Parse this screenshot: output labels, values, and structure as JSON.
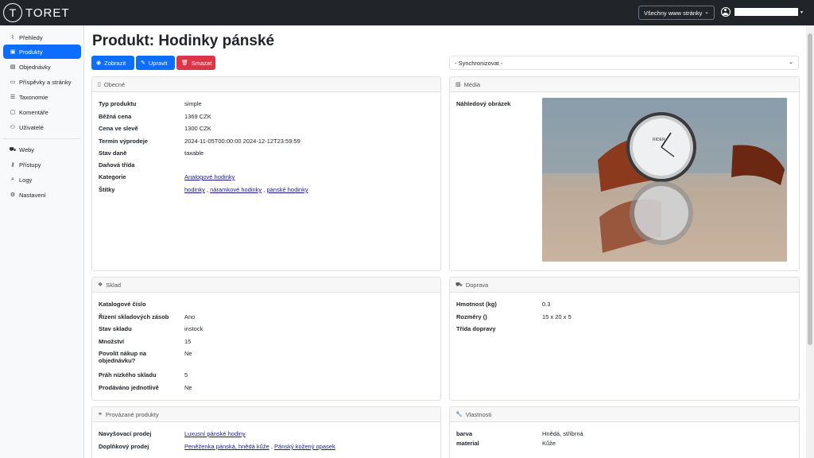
{
  "app": {
    "logo_letter": "T",
    "logo_text": "TORET"
  },
  "topbar": {
    "site_select": "Všechny www stránky",
    "user_caret": "▾"
  },
  "sidebar": {
    "items": [
      {
        "label": "Přehledy",
        "icon": "chart-icon",
        "glyph": "⌇"
      },
      {
        "label": "Produkty",
        "icon": "box-icon",
        "glyph": "▣"
      },
      {
        "label": "Objednávky",
        "icon": "receipt-icon",
        "glyph": "▤"
      },
      {
        "label": "Příspěvky a stránky",
        "icon": "document-icon",
        "glyph": "▭"
      },
      {
        "label": "Taxonomie",
        "icon": "list-icon",
        "glyph": "☰"
      },
      {
        "label": "Komentáře",
        "icon": "comment-icon",
        "glyph": "▢"
      },
      {
        "label": "Uživatelé",
        "icon": "users-icon",
        "glyph": "⚇"
      },
      {
        "label": "Weby",
        "icon": "cart-icon",
        "glyph": "⛟"
      },
      {
        "label": "Přístupy",
        "icon": "key-icon",
        "glyph": "⚷"
      },
      {
        "label": "Logy",
        "icon": "search-icon",
        "glyph": "⌕"
      },
      {
        "label": "Nastavení",
        "icon": "gear-icon",
        "glyph": "⚙"
      }
    ]
  },
  "page": {
    "title": "Produkt: Hodinky pánské",
    "buttons": {
      "view": "Zobrazit",
      "edit": "Upravit",
      "delete": "Smazat"
    },
    "sync_select": "- Synchronizovat -"
  },
  "general": {
    "title": "Obecné",
    "rows": [
      {
        "label": "Typ produktu",
        "value": "simple"
      },
      {
        "label": "Běžná cena",
        "value": "1369 CZK"
      },
      {
        "label": "Cena ve slevě",
        "value": "1300 CZK"
      },
      {
        "label": "Termín výprodeje",
        "value": "2024-11-05T00:00:00 2024-12-12T23:59:59"
      },
      {
        "label": "Stav daně",
        "value": "taxable"
      },
      {
        "label": "Daňová třída",
        "value": ""
      },
      {
        "label": "Kategorie",
        "value": ""
      },
      {
        "label": "Štítky",
        "value": ""
      }
    ],
    "category_link": "Analogové hodinky",
    "tags": [
      "hodinky",
      "náramkové hodinky",
      "pánské hodinky"
    ],
    "sep": ","
  },
  "media": {
    "title": "Média",
    "preview_label": "Náhledový obrázek",
    "watch_brand": "RIDER"
  },
  "stock": {
    "title": "Sklad",
    "rows": [
      {
        "label": "Katalogové číslo",
        "value": ""
      },
      {
        "label": "Řízení skladových zásob",
        "value": "Ano"
      },
      {
        "label": "Stav skladu",
        "value": "instock"
      },
      {
        "label": "Množství",
        "value": "15"
      },
      {
        "label": "Povolit nákup na objednávku?",
        "value": "Ne"
      },
      {
        "label": "Práh nízkého skladu",
        "value": "5"
      },
      {
        "label": "Prodáváno jednotlivě",
        "value": "Ne"
      }
    ]
  },
  "shipping": {
    "title": "Doprava",
    "rows": [
      {
        "label": "Hmotnost (kg)",
        "value": "0.3"
      },
      {
        "label": "Rozměry ()",
        "value": "15 x 20 x 5"
      },
      {
        "label": "Třída dopravy",
        "value": ""
      }
    ]
  },
  "linked": {
    "title": "Provázané produkty",
    "upsell_label": "Navyšovací prodej",
    "upsell_link": "Luxusní pánské hodiny",
    "cross_label": "Doplňkový prodej",
    "cross_links": [
      "Peněženka pánská, hnědá kůže",
      "Pánský kožený opasek"
    ]
  },
  "attributes": {
    "title": "Vlastnosti",
    "rows": [
      {
        "label": "barva",
        "value": "Hnědá, stříbrná"
      },
      {
        "label": "material",
        "value": "Kůže"
      }
    ]
  },
  "colors": {
    "primary": "#0d6efd",
    "danger": "#dc3545",
    "topbar": "#212529"
  }
}
